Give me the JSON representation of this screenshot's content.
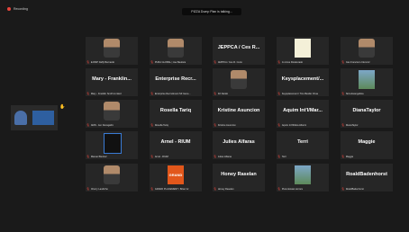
{
  "top": {
    "recording": "Recording",
    "speaking": "PIZZA Dump Plan is talking..."
  },
  "tiles": [
    {
      "name": "",
      "label": "E.DMP Daffy Bernardo",
      "pic": "photo"
    },
    {
      "name": "",
      "label": "PURA GLOBAL | Jae Bautista",
      "pic": "photo"
    },
    {
      "name": "JEPPCA / Ces R...",
      "label": "JEPPCA / Ces R. Curio",
      "pic": ""
    },
    {
      "name": "",
      "label": "Jo Anne Dioskorado",
      "pic": "logo"
    },
    {
      "name": "",
      "label": "Cas Francisco Clemntz",
      "pic": "photo"
    },
    {
      "name": "Mary - Franklin...",
      "label": "Mary - Franklin Smith Limited",
      "pic": ""
    },
    {
      "name": "Enterprise Recr...",
      "label": "Enterprise Recruitment SZ Gene...",
      "pic": ""
    },
    {
      "name": "",
      "label": "DJ Danilo",
      "pic": "photo"
    },
    {
      "name": "Keysplacement/...",
      "label": "Keysplacement / Tino Besilio Chua",
      "pic": ""
    },
    {
      "name": "",
      "label": "Nora Evangelista",
      "pic": "scene"
    },
    {
      "name": "",
      "label": "AMD - Jen Decagabro",
      "pic": "photo"
    },
    {
      "name": "Rosella Tariq",
      "label": "Rosella Tariq",
      "pic": ""
    },
    {
      "name": "Kristine Asuncion",
      "label": "Kristine Asuncion",
      "pic": ""
    },
    {
      "name": "Aquim Int'l/Mar...",
      "label": "Aquim Int'l/Mara Alberto",
      "pic": ""
    },
    {
      "name": "DianaTaylor",
      "label": "DianaTaylor",
      "pic": ""
    },
    {
      "name": "",
      "label": "Manuel Benitez",
      "pic": "mlogo"
    },
    {
      "name": "Arnel - RIUM",
      "label": "Arnel - RIUM",
      "pic": ""
    },
    {
      "name": "Julies Alfaras",
      "label": "Julies Alfaras",
      "pic": ""
    },
    {
      "name": "Terri",
      "label": "Terri",
      "pic": ""
    },
    {
      "name": "Maggie",
      "label": "Maggie",
      "pic": ""
    },
    {
      "name": "",
      "label": "Cherry Landicho",
      "pic": "photo"
    },
    {
      "name": "",
      "label": "GRAND PLACEMENT / Brian Gr",
      "pic": "grand"
    },
    {
      "name": "Honey Raselan",
      "label": "Honey Raselan",
      "pic": ""
    },
    {
      "name": "",
      "label": "Piura Estate Herrera",
      "pic": "scene"
    },
    {
      "name": "RoaldBadenhorst",
      "label": "RoaldBadenhorst",
      "pic": ""
    }
  ],
  "grand_text": "GRAND"
}
